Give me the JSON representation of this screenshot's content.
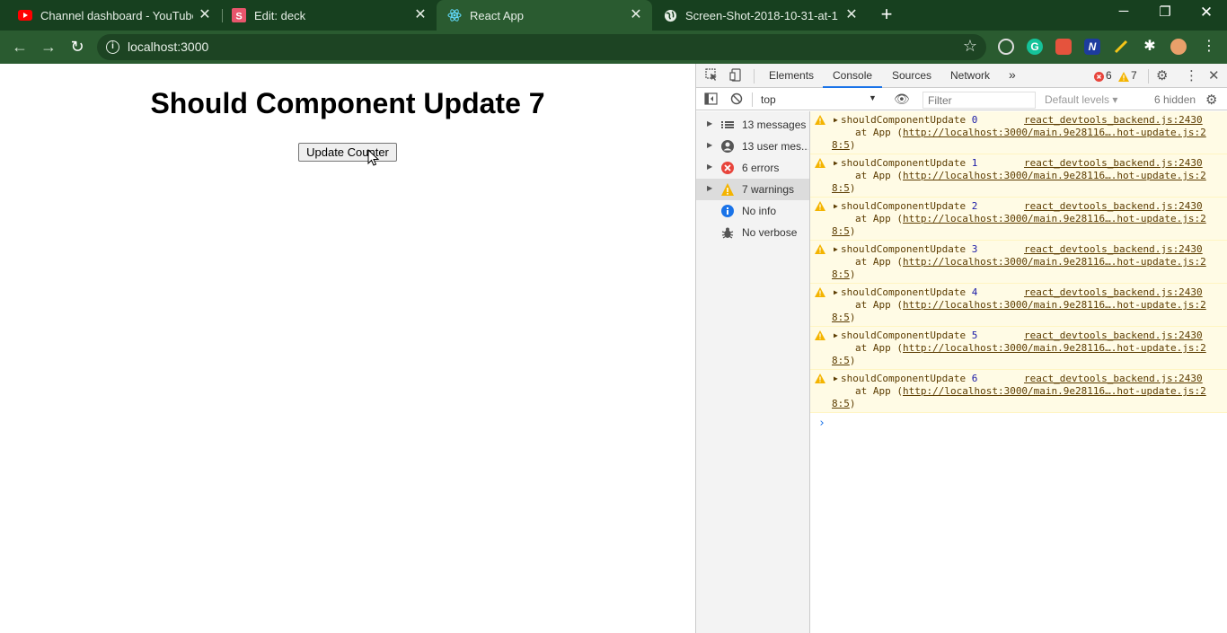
{
  "browser": {
    "tabs": [
      {
        "title": "Channel dashboard - YouTube St",
        "active": false,
        "favicon": "youtube-icon"
      },
      {
        "title": "Edit: deck",
        "active": false,
        "favicon": "slides-s-icon"
      },
      {
        "title": "React App",
        "active": true,
        "favicon": "react-icon"
      },
      {
        "title": "Screen-Shot-2018-10-31-at-1.44",
        "active": false,
        "favicon": "globe-icon"
      }
    ],
    "new_tab": "+",
    "url": "localhost:3000"
  },
  "page": {
    "heading": "Should Component Update 7",
    "button_label": "Update Counter"
  },
  "devtools": {
    "tabs": [
      "Elements",
      "Console",
      "Sources",
      "Network"
    ],
    "more_tabs": "»",
    "error_count": "6",
    "warning_count": "7",
    "context": "top",
    "filter_placeholder": "Filter",
    "levels": "Default levels",
    "hidden": "6 hidden",
    "sidebar": [
      {
        "label": "13 messages",
        "icon": "list-icon"
      },
      {
        "label": "13 user mes...",
        "icon": "user-icon"
      },
      {
        "label": "6 errors",
        "icon": "error-icon"
      },
      {
        "label": "7 warnings",
        "icon": "warning-icon"
      },
      {
        "label": "No info",
        "icon": "info-icon"
      },
      {
        "label": "No verbose",
        "icon": "bug-icon"
      }
    ],
    "messages": [
      {
        "text": "shouldComponentUpdate",
        "num": "0",
        "source": "react_devtools_backend.js:2430",
        "at_prefix": "at App (",
        "link": "http://localhost:3000/main.9e28116….hot-update.js:2",
        "link_cont": "8:5",
        "close": ")"
      },
      {
        "text": "shouldComponentUpdate",
        "num": "1",
        "source": "react_devtools_backend.js:2430",
        "at_prefix": "at App (",
        "link": "http://localhost:3000/main.9e28116….hot-update.js:2",
        "link_cont": "8:5",
        "close": ")"
      },
      {
        "text": "shouldComponentUpdate",
        "num": "2",
        "source": "react_devtools_backend.js:2430",
        "at_prefix": "at App (",
        "link": "http://localhost:3000/main.9e28116….hot-update.js:2",
        "link_cont": "8:5",
        "close": ")"
      },
      {
        "text": "shouldComponentUpdate",
        "num": "3",
        "source": "react_devtools_backend.js:2430",
        "at_prefix": "at App (",
        "link": "http://localhost:3000/main.9e28116….hot-update.js:2",
        "link_cont": "8:5",
        "close": ")"
      },
      {
        "text": "shouldComponentUpdate",
        "num": "4",
        "source": "react_devtools_backend.js:2430",
        "at_prefix": "at App (",
        "link": "http://localhost:3000/main.9e28116….hot-update.js:2",
        "link_cont": "8:5",
        "close": ")"
      },
      {
        "text": "shouldComponentUpdate",
        "num": "5",
        "source": "react_devtools_backend.js:2430",
        "at_prefix": "at App (",
        "link": "http://localhost:3000/main.9e28116….hot-update.js:2",
        "link_cont": "8:5",
        "close": ")"
      },
      {
        "text": "shouldComponentUpdate",
        "num": "6",
        "source": "react_devtools_backend.js:2430",
        "at_prefix": "at App (",
        "link": "http://localhost:3000/main.9e28116….hot-update.js:2",
        "link_cont": "8:5",
        "close": ")"
      }
    ],
    "prompt": "›"
  },
  "colors": {
    "tab_strip": "#17401f",
    "toolbar": "#2a5b30",
    "warning_bg": "#fffbe5",
    "warning_icon": "#f4b400",
    "error_icon": "#e8453c",
    "accent": "#1a73e8"
  }
}
